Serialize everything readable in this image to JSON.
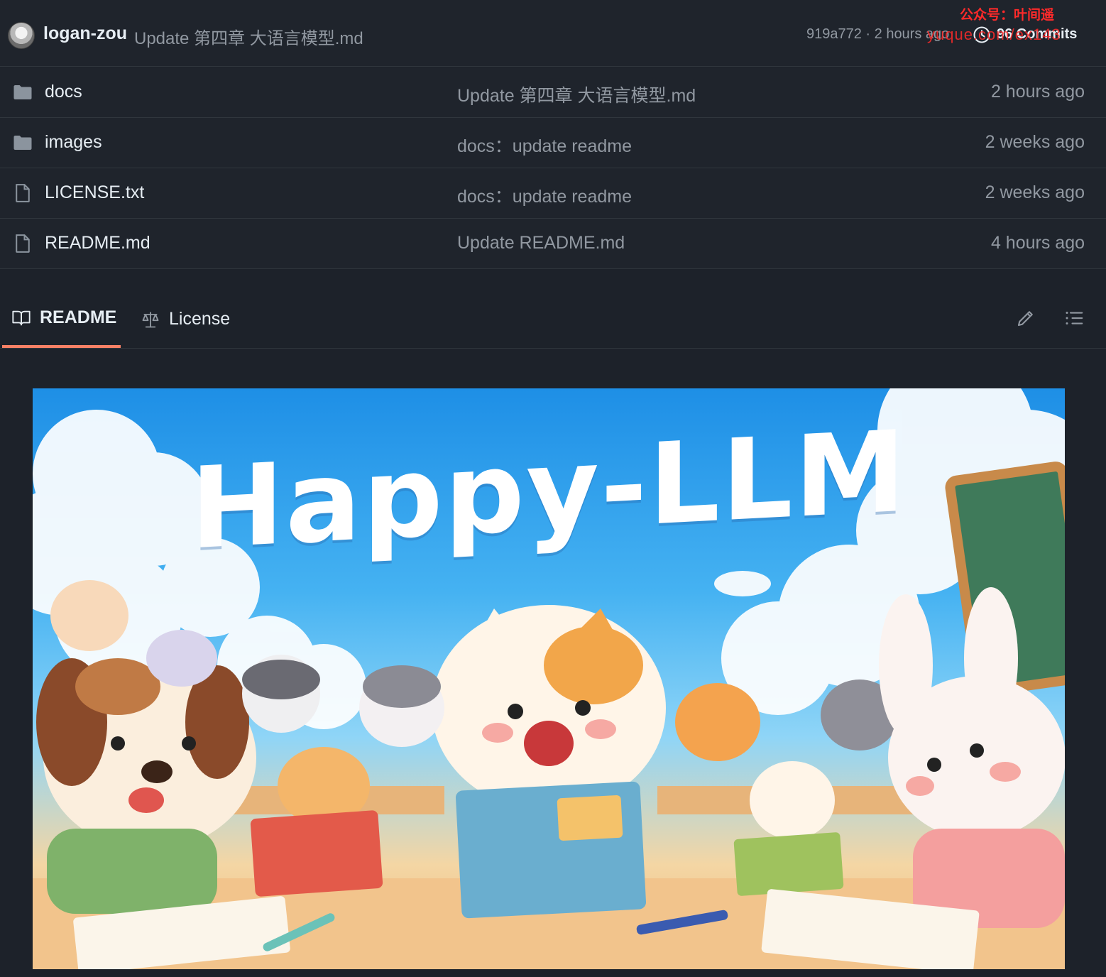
{
  "latest_commit": {
    "author": "logan-zou",
    "message": "Update 第四章 大语言模型.md",
    "meta": "919a772 · 2 hours ago",
    "commits_label": "96 Commits"
  },
  "watermark": {
    "line1": "公众号：叶间遥",
    "line2": "yuque.com/ex143"
  },
  "files": [
    {
      "name": "docs",
      "icon": "folder-icon",
      "message": "Update 第四章 大语言模型.md",
      "time": "2 hours ago"
    },
    {
      "name": "images",
      "icon": "folder-icon",
      "message": "docs：update readme",
      "time": "2 weeks ago"
    },
    {
      "name": "LICENSE.txt",
      "icon": "file-icon",
      "message": "docs：update readme",
      "time": "2 weeks ago"
    },
    {
      "name": "README.md",
      "icon": "file-icon",
      "message": "Update README.md",
      "time": "4 hours ago"
    }
  ],
  "tabs": {
    "readme": "README",
    "license": "License"
  },
  "banner": {
    "title": "Happy-LLM"
  },
  "colors": {
    "background": "#1d222a",
    "accent_tab": "#f78166",
    "muted_text": "#9198a1"
  }
}
